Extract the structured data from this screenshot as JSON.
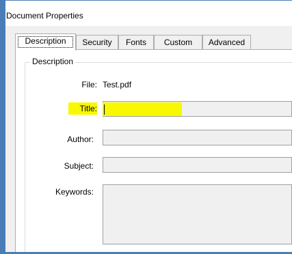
{
  "window": {
    "title": "Document Properties"
  },
  "tabs": [
    {
      "label": "Description",
      "active": true
    },
    {
      "label": "Security",
      "active": false
    },
    {
      "label": "Fonts",
      "active": false
    },
    {
      "label": "Custom",
      "active": false
    },
    {
      "label": "Advanced",
      "active": false
    }
  ],
  "description": {
    "group_label": "Description",
    "file": {
      "label": "File:",
      "value": "Test.pdf"
    },
    "title": {
      "label": "Title:",
      "value": ""
    },
    "author": {
      "label": "Author:",
      "value": ""
    },
    "subject": {
      "label": "Subject:",
      "value": ""
    },
    "keywords": {
      "label": "Keywords:",
      "value": ""
    }
  },
  "colors": {
    "highlight": "#f8f800",
    "field_bg": "#f0f0f0",
    "frame": "#4a7db8"
  }
}
